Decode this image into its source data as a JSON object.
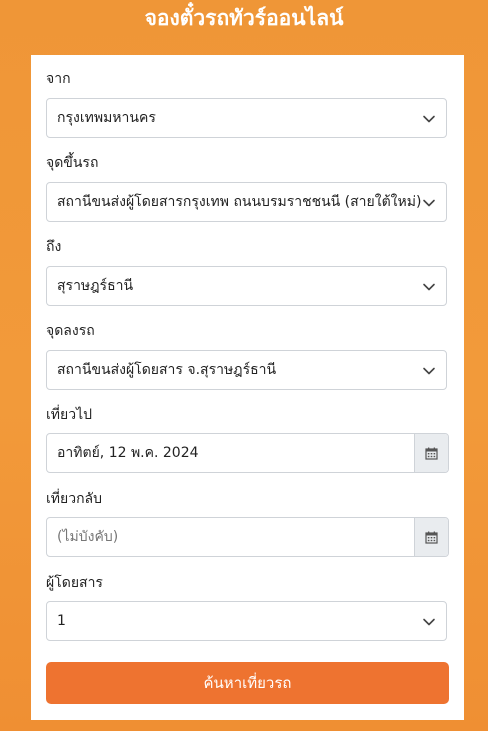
{
  "header": {
    "title": "จองตั๋วรถทัวร์ออนไลน์"
  },
  "form": {
    "origin": {
      "label": "จาก",
      "value": "กรุงเทพมหานคร"
    },
    "boarding_point": {
      "label": "จุดขึ้นรถ",
      "value": "สถานีขนส่งผู้โดยสารกรุงเทพ ถนนบรมราชชนนี (สายใต้ใหม่)"
    },
    "destination": {
      "label": "ถึง",
      "value": "สุราษฎร์ธานี"
    },
    "dropoff_point": {
      "label": "จุดลงรถ",
      "value": "สถานีขนส่งผู้โดยสาร จ.สุราษฎร์ธานี"
    },
    "departure_date": {
      "label": "เที่ยวไป",
      "value": "อาทิตย์, 12 พ.ค. 2024"
    },
    "return_date": {
      "label": "เที่ยวกลับ",
      "placeholder": "(ไม่บังคับ)"
    },
    "passengers": {
      "label": "ผู้โดยสาร",
      "value": "1"
    },
    "search_button": {
      "label": "ค้นหาเที่ยวรถ"
    }
  },
  "icons": {
    "select_arrow": "chevron-down-icon",
    "date_picker": "calendar-icon"
  },
  "colors": {
    "background": "#ef9637",
    "button": "#ee7330",
    "card": "#ffffff"
  }
}
